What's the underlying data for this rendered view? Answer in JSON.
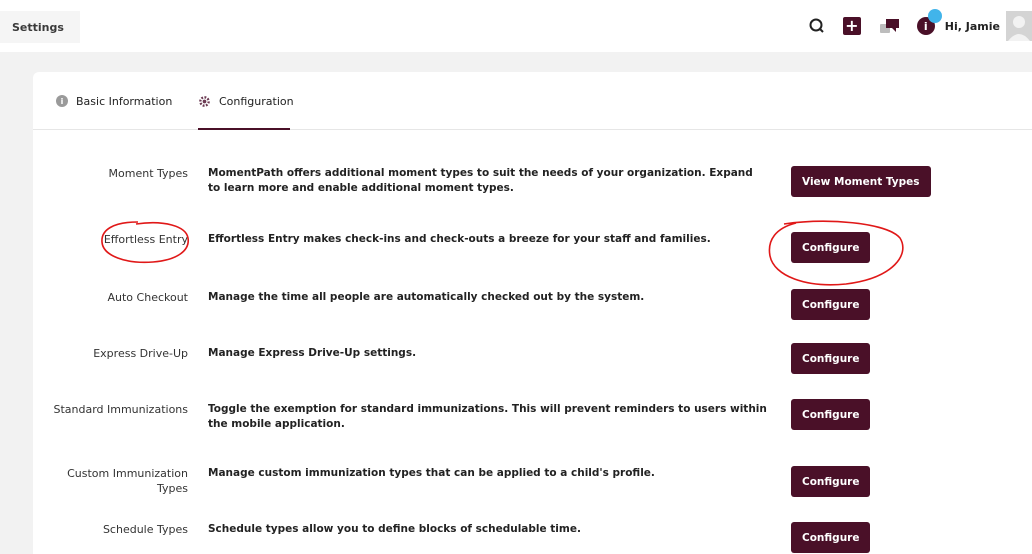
{
  "header": {
    "breadcrumb": "Settings",
    "greeting": "Hi, Jamie",
    "plus_icon": "+",
    "info_icon": "i"
  },
  "tabs": [
    {
      "label": "Basic Information",
      "icon": "info-icon",
      "active": false
    },
    {
      "label": "Configuration",
      "icon": "gear-icon",
      "active": true
    }
  ],
  "settings": [
    {
      "label": "Moment Types",
      "description": "MomentPath offers additional moment types to suit the needs of your organization. Expand to learn more and enable additional moment types.",
      "button": "View Moment Types"
    },
    {
      "label": "Effortless Entry",
      "description": "Effortless Entry makes check-ins and check-outs a breeze for your staff and families.",
      "button": "Configure"
    },
    {
      "label": "Auto Checkout",
      "description": "Manage the time all people are automatically checked out by the system.",
      "button": "Configure"
    },
    {
      "label": "Express Drive-Up",
      "description": "Manage Express Drive-Up settings.",
      "button": "Configure"
    },
    {
      "label": "Standard Immunizations",
      "description": "Toggle the exemption for standard immunizations. This will prevent reminders to users within the mobile application.",
      "button": "Configure"
    },
    {
      "label": "Custom Immunization Types",
      "description": "Manage custom immunization types that can be applied to a child's profile.",
      "button": "Configure"
    },
    {
      "label": "Schedule Types",
      "description": "Schedule types allow you to define blocks of schedulable time.",
      "button": "Configure"
    }
  ],
  "colors": {
    "brand": "#4a1028",
    "notification": "#41b4ea",
    "annotation": "#e01818"
  }
}
